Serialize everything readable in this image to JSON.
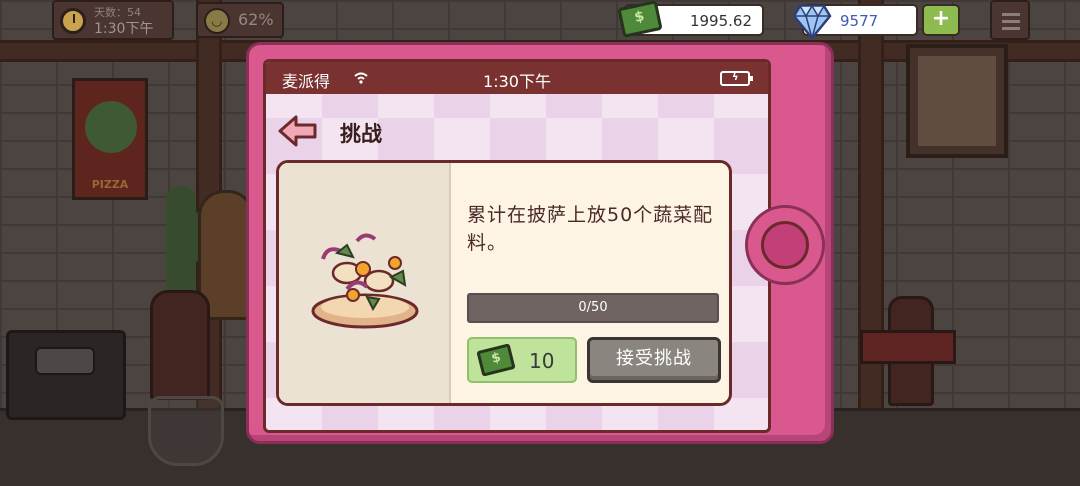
{
  "hud": {
    "days_label": "天数：54",
    "time": "1:30下午",
    "mood_percent": "62%",
    "money": "1995.62",
    "gems": "9577",
    "add_label": "+"
  },
  "phone": {
    "carrier": "麦派得",
    "status_time": "1:30下午",
    "screen_title": "挑战",
    "challenge": {
      "description": "累计在披萨上放50个蔬菜配料。",
      "progress_current": 0,
      "progress_total": 50,
      "progress_text": "0/50",
      "reward": "10",
      "accept_label": "接受挑战"
    }
  },
  "colors": {
    "phone_body": "#d9598f",
    "status_bar": "#7a3231",
    "reward_bg": "#bfe39b",
    "accept_btn": "#8b8580"
  },
  "icons": [
    "clock-icon",
    "smile-icon",
    "money-icon",
    "gem-icon",
    "menu-icon",
    "wifi-icon",
    "battery-icon",
    "back-arrow-icon",
    "cash-icon",
    "home-button"
  ]
}
